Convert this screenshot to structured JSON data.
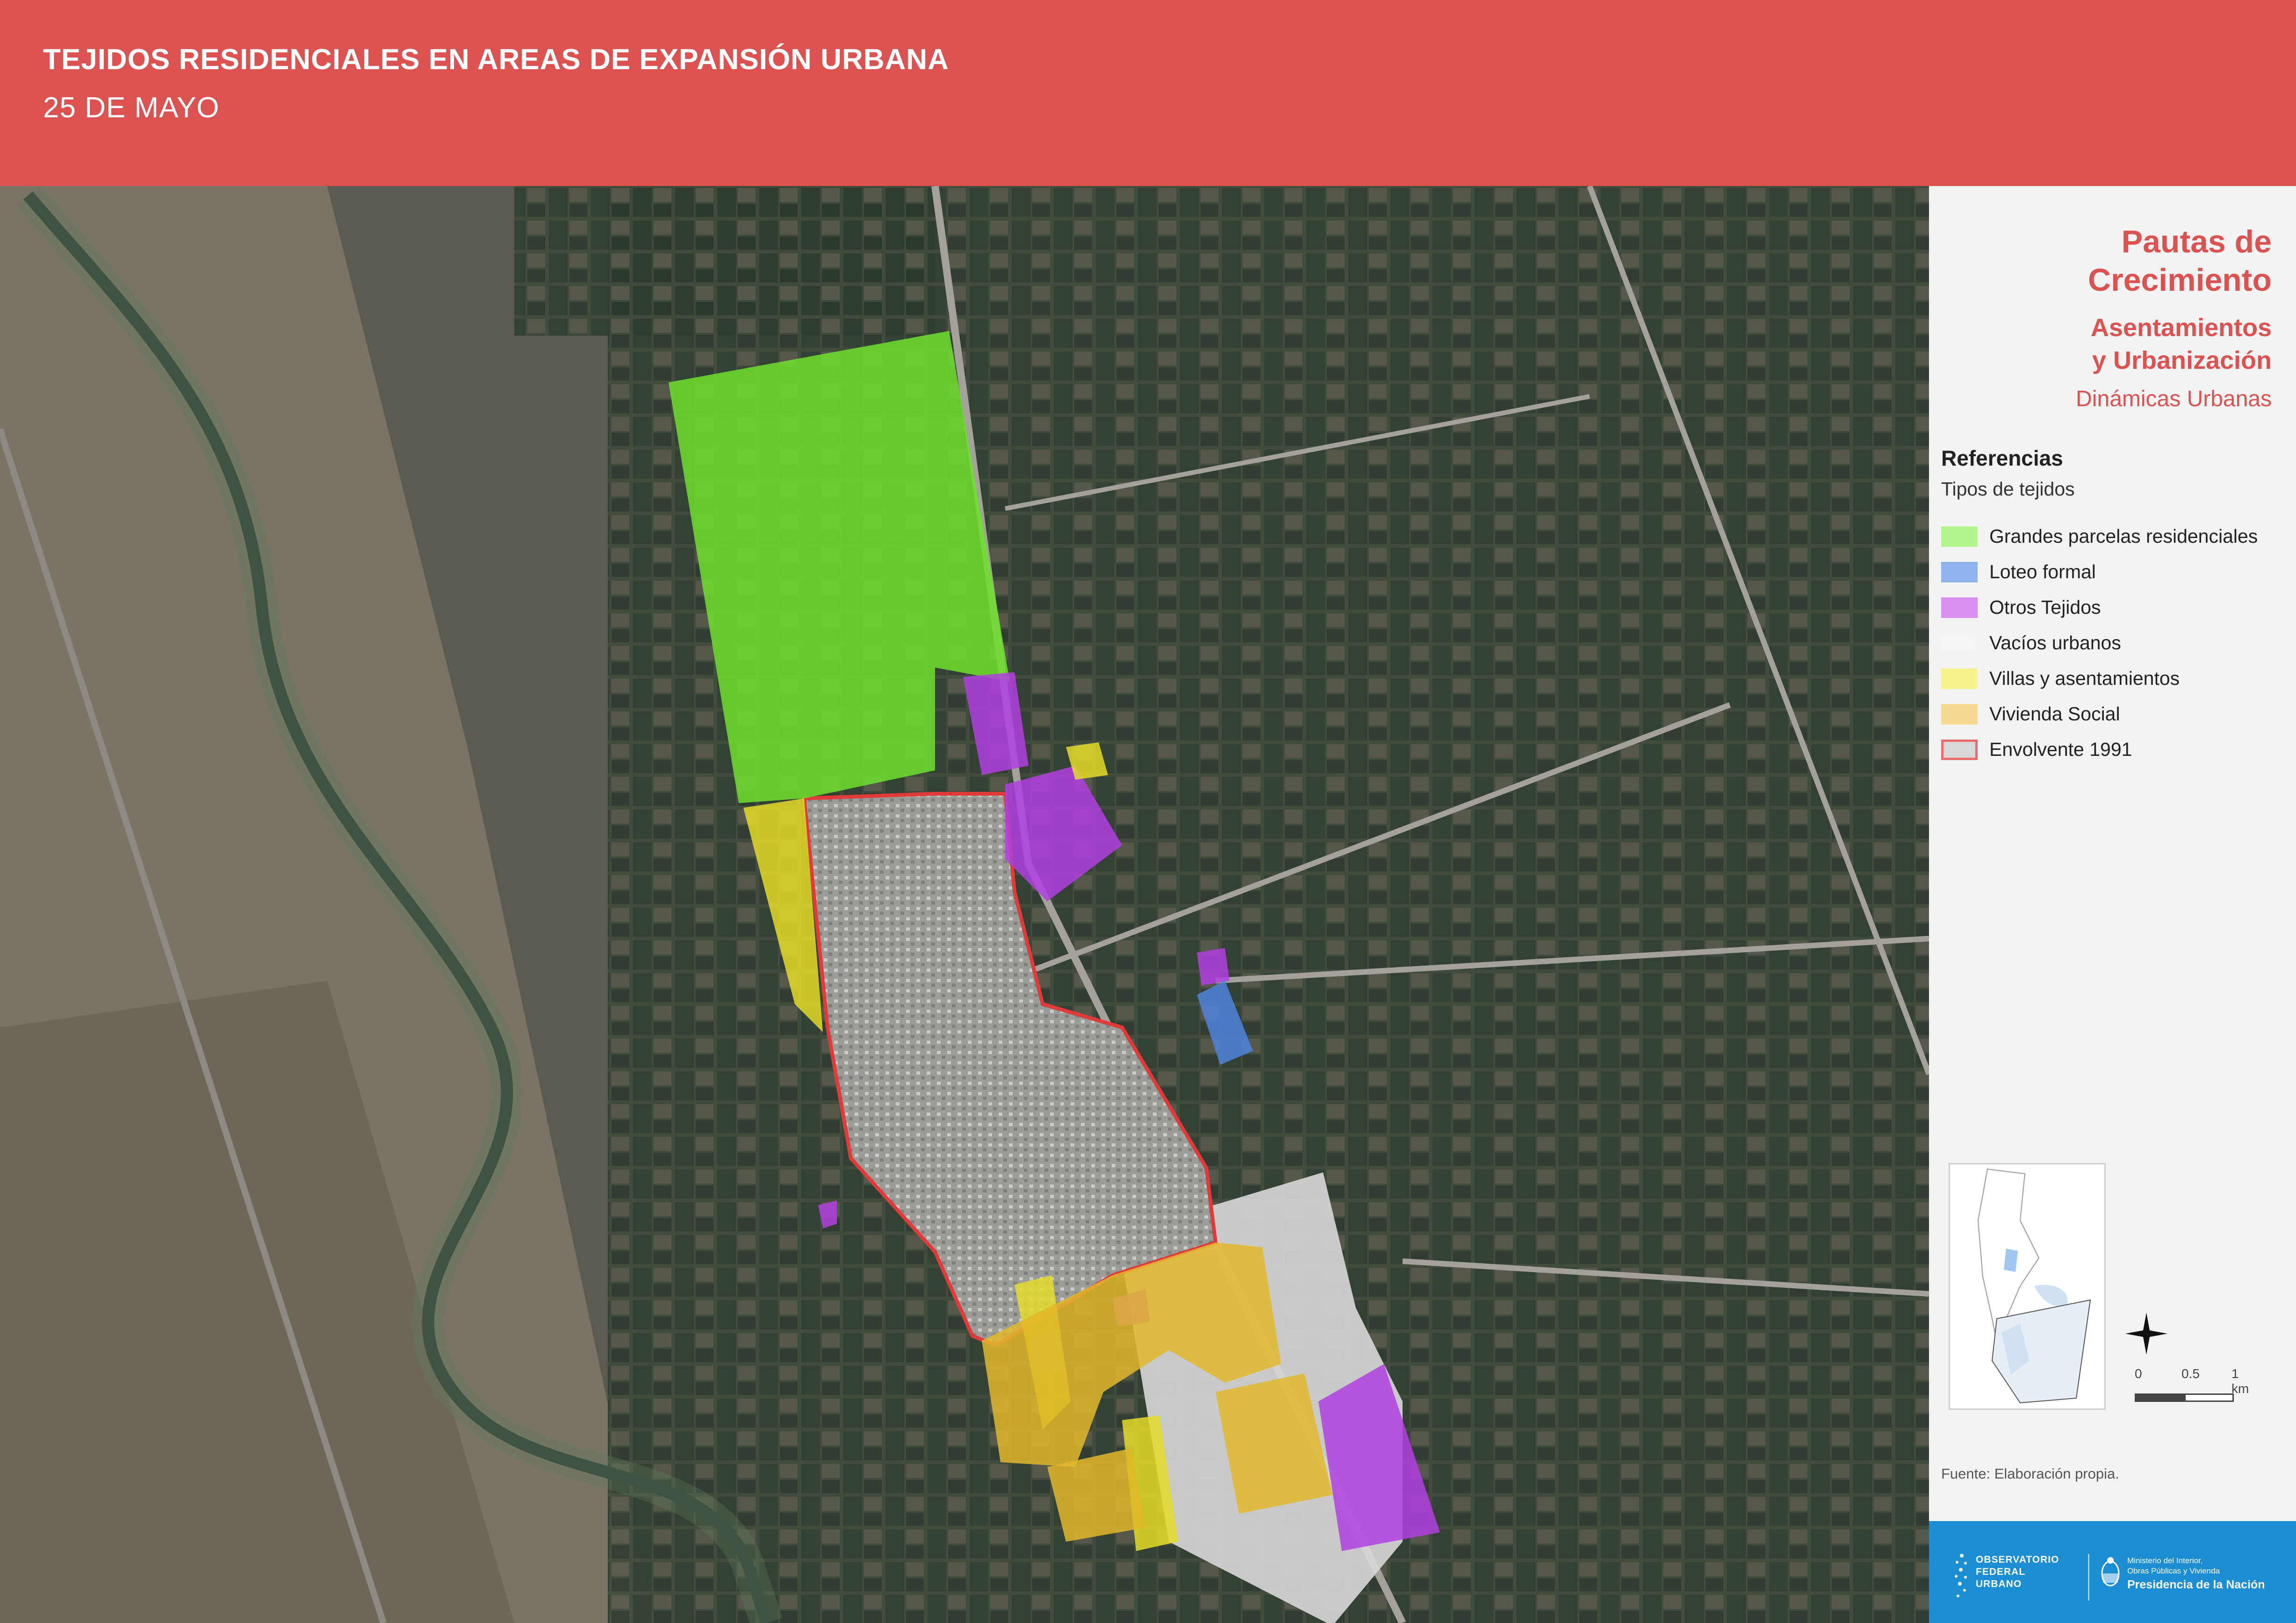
{
  "header": {
    "title": "TEJIDOS RESIDENCIALES EN AREAS DE EXPANSIÓN URBANA",
    "subtitle": "25 DE MAYO"
  },
  "panel": {
    "title": "Pautas de\nCrecimiento",
    "subtitle": "Asentamientos\ny Urbanización",
    "subtitle2": "Dinámicas Urbanas",
    "references_heading": "Referencias",
    "references_subheading": "Tipos de tejidos",
    "legend": [
      {
        "label": "Grandes parcelas residenciales",
        "color": "#b5f58f",
        "border": "#b5f58f"
      },
      {
        "label": "Loteo formal",
        "color": "#8fb1ec",
        "border": "#8fb1ec"
      },
      {
        "label": "Otros Tejidos",
        "color": "#d98ff0",
        "border": "#d98ff0"
      },
      {
        "label": "Vacíos urbanos",
        "color": "#f4f4f4",
        "border": "#f4f4f4"
      },
      {
        "label": "Villas y asentamientos",
        "color": "#f8f38c",
        "border": "#f8f38c"
      },
      {
        "label": "Vivienda Social",
        "color": "#f5d990",
        "border": "#f5d990"
      },
      {
        "label": "Envolvente 1991",
        "color": "#d9d9d9",
        "border": "#ee6b6b"
      }
    ],
    "scale": {
      "t0": "0",
      "t1": "0.5",
      "t2": "1 km"
    },
    "source": "Fuente: Elaboración propia."
  },
  "footer": {
    "observatorio": "OBSERVATORIO\nFEDERAL\nURBANO",
    "ministerio": "Ministerio del Interior,\nObras Públicas y Vivienda",
    "presidencia": "Presidencia de la Nación"
  },
  "map_layers": {
    "grandes_parcelas": "#6ee12f",
    "loteo_formal": "#4f82dc",
    "otros_tejidos": "#b13fe0",
    "vacios_urbanos": "#d8d8d8",
    "villas": "#e5dc2a",
    "vivienda_social": "#e2b82c",
    "envolvente": "#e03a3a"
  }
}
